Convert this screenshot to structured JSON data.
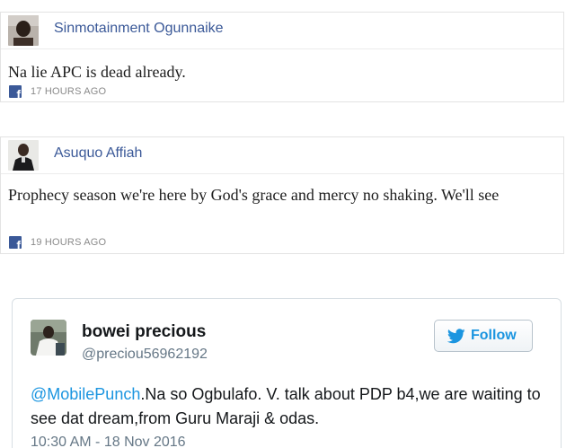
{
  "comments": [
    {
      "author": "Sinmotainment Ogunnaike",
      "text": "Na lie APC is dead already.",
      "timestamp": "17 HOURS AGO",
      "source_icon": "facebook-icon"
    },
    {
      "author": "Asuquo Affiah",
      "text": "Prophecy season we're here by God's grace and mercy no shaking. We'll see",
      "timestamp": "19 HOURS AGO",
      "source_icon": "facebook-icon"
    }
  ],
  "tweet": {
    "display_name": "bowei precious",
    "handle": "@preciou56962192",
    "follow_label": "Follow",
    "mention": "@MobilePunch",
    "body": ".Na so Ogbulafo. V. talk about PDP b4,we are waiting to see dat dream,from Guru Maraji & odas.",
    "date": "10:30 AM - 18 Nov 2016",
    "follow_icon": "twitter-bird-icon"
  },
  "colors": {
    "facebook_blue": "#3b5998",
    "twitter_blue": "#1b95e0",
    "meta_gray": "#8a8a8a"
  }
}
